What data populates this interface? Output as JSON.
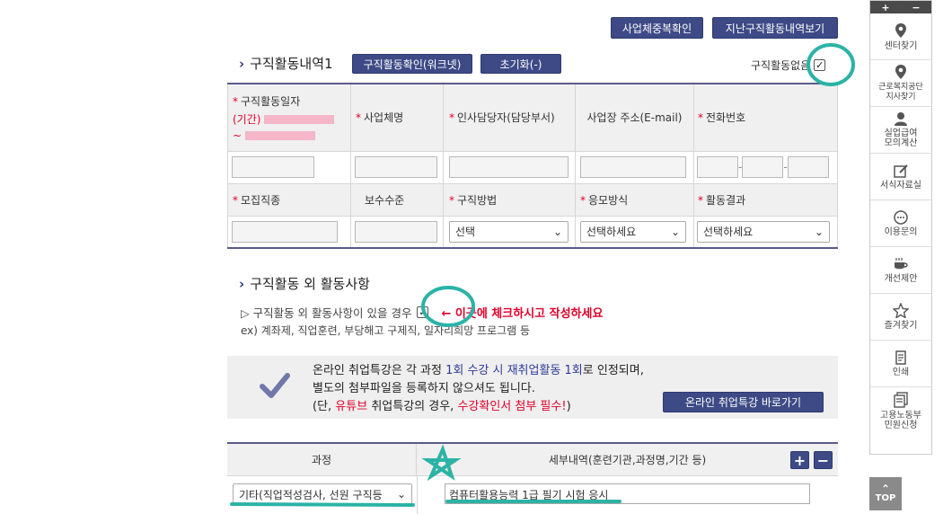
{
  "top_buttons": {
    "dup_check": "사업체중복확인",
    "past_history": "지난구직활동내역보기"
  },
  "section1": {
    "title": "구직활동내역1",
    "worknet_btn": "구직활동확인(워크넷)",
    "reset_btn": "초기화(-)",
    "no_activity_label": "구직활동없음",
    "headers": {
      "date": "구직활동일자",
      "period": "(기간)",
      "tilde": "~",
      "company": "사업체명",
      "hr": "인사담당자(담당부서)",
      "address": "사업장 주소(E-mail)",
      "phone": "전화번호",
      "job": "모집직종",
      "salary": "보수수준",
      "method": "구직방법",
      "apply": "응모방식",
      "result": "활동결과"
    },
    "selects": {
      "method": "선택",
      "apply": "선택하세요",
      "result": "선택하세요"
    },
    "phone_sep": "-"
  },
  "section2": {
    "title": "구직활동 외 활동사항",
    "check_line": "▷ 구직활동 외 활동사항이 있을 경우",
    "arrow_note": "← 이곳에 체크하시고 작성하세요",
    "example": "ex) 계좌제, 직업훈련, 부당해고 구제직, 일자리희망 프로그램 등"
  },
  "notice": {
    "line1_pre": "온라인 취업특강은 각 과정 ",
    "line1_hl": "1회 수강 시 재취업활동 1회",
    "line1_post": "로 인정되며,",
    "line2": "별도의 첨부파일을 등록하지 않으셔도 됩니다.",
    "line3_a": "(단, ",
    "line3_b": "유튜브",
    "line3_c": " 취업특강의 경우, ",
    "line3_d": "수강확인서 첨부 필수!",
    "line3_e": ")",
    "button": "온라인 취업특강 바로가기"
  },
  "course_table": {
    "col_course": "과정",
    "col_detail": "세부내역(훈련기관,과정명,기간 등)",
    "add": "+",
    "remove": "−",
    "course_value": "기타(직업적성검사, 선원 구직등",
    "detail_value": "컴퓨터활용능력 1급 필기 시험 응시"
  },
  "sidebar": {
    "plus": "+",
    "minus": "−",
    "items": [
      {
        "label": "센터찾기",
        "icon": "map-pin-icon"
      },
      {
        "label": "근로복지공단\n지사찾기",
        "icon": "map-pin-icon"
      },
      {
        "label": "실업급여\n모의계산",
        "icon": "user-icon"
      },
      {
        "label": "서식자료실",
        "icon": "edit-icon"
      },
      {
        "label": "이용문의",
        "icon": "chat-icon"
      },
      {
        "label": "개선제안",
        "icon": "coffee-icon"
      },
      {
        "label": "즐겨찾기",
        "icon": "star-icon"
      },
      {
        "label": "인쇄",
        "icon": "print-icon"
      },
      {
        "label": "고용노동부\n민원신청",
        "icon": "document-icon"
      }
    ],
    "top_label": "TOP"
  },
  "colors": {
    "navy": "#3d4a86",
    "red": "#e0002a",
    "teal": "#2bb3a6"
  }
}
